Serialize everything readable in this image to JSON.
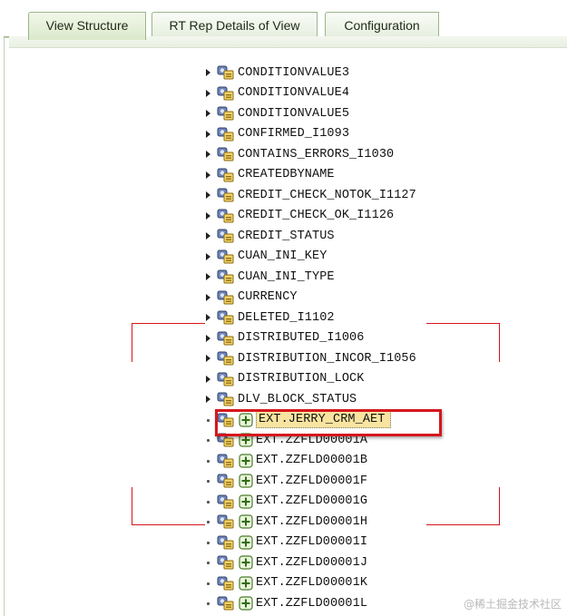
{
  "tabs": [
    {
      "label": "View Structure",
      "active": true
    },
    {
      "label": "RT Rep Details of View",
      "active": false
    },
    {
      "label": "Configuration",
      "active": false
    }
  ],
  "tree": {
    "nodes": [
      {
        "label": "CONDITIONVALUE3",
        "kind": "expandable"
      },
      {
        "label": "CONDITIONVALUE4",
        "kind": "expandable"
      },
      {
        "label": "CONDITIONVALUE5",
        "kind": "expandable"
      },
      {
        "label": "CONFIRMED_I1093",
        "kind": "expandable"
      },
      {
        "label": "CONTAINS_ERRORS_I1030",
        "kind": "expandable"
      },
      {
        "label": "CREATEDBYNAME",
        "kind": "expandable"
      },
      {
        "label": "CREDIT_CHECK_NOTOK_I1127",
        "kind": "expandable"
      },
      {
        "label": "CREDIT_CHECK_OK_I1126",
        "kind": "expandable"
      },
      {
        "label": "CREDIT_STATUS",
        "kind": "expandable"
      },
      {
        "label": "CUAN_INI_KEY",
        "kind": "expandable"
      },
      {
        "label": "CUAN_INI_TYPE",
        "kind": "expandable"
      },
      {
        "label": "CURRENCY",
        "kind": "expandable"
      },
      {
        "label": "DELETED_I1102",
        "kind": "expandable"
      },
      {
        "label": "DISTRIBUTED_I1006",
        "kind": "expandable"
      },
      {
        "label": "DISTRIBUTION_INCOR_I1056",
        "kind": "expandable"
      },
      {
        "label": "DISTRIBUTION_LOCK",
        "kind": "expandable"
      },
      {
        "label": "DLV_BLOCK_STATUS",
        "kind": "expandable"
      },
      {
        "label": "EXT.JERRY_CRM_AET",
        "kind": "leaf-ext",
        "selected": true
      },
      {
        "label": "EXT.ZZFLD00001A",
        "kind": "leaf-ext"
      },
      {
        "label": "EXT.ZZFLD00001B",
        "kind": "leaf-ext"
      },
      {
        "label": "EXT.ZZFLD00001F",
        "kind": "leaf-ext"
      },
      {
        "label": "EXT.ZZFLD00001G",
        "kind": "leaf-ext"
      },
      {
        "label": "EXT.ZZFLD00001H",
        "kind": "leaf-ext"
      },
      {
        "label": "EXT.ZZFLD00001I",
        "kind": "leaf-ext"
      },
      {
        "label": "EXT.ZZFLD00001J",
        "kind": "leaf-ext"
      },
      {
        "label": "EXT.ZZFLD00001K",
        "kind": "leaf-ext"
      },
      {
        "label": "EXT.ZZFLD00001L",
        "kind": "leaf-ext"
      }
    ]
  },
  "icons": {
    "node": "attribute-node-icon",
    "ext": "enhancement-plus-icon",
    "expand": "expand-triangle-icon",
    "leaf": "leaf-dot-icon"
  },
  "colors": {
    "highlight_box": "#d6161c",
    "selected_bg": "#f8e4a0",
    "tab_border": "#9ab58a"
  },
  "watermark": "@稀土掘金技术社区"
}
